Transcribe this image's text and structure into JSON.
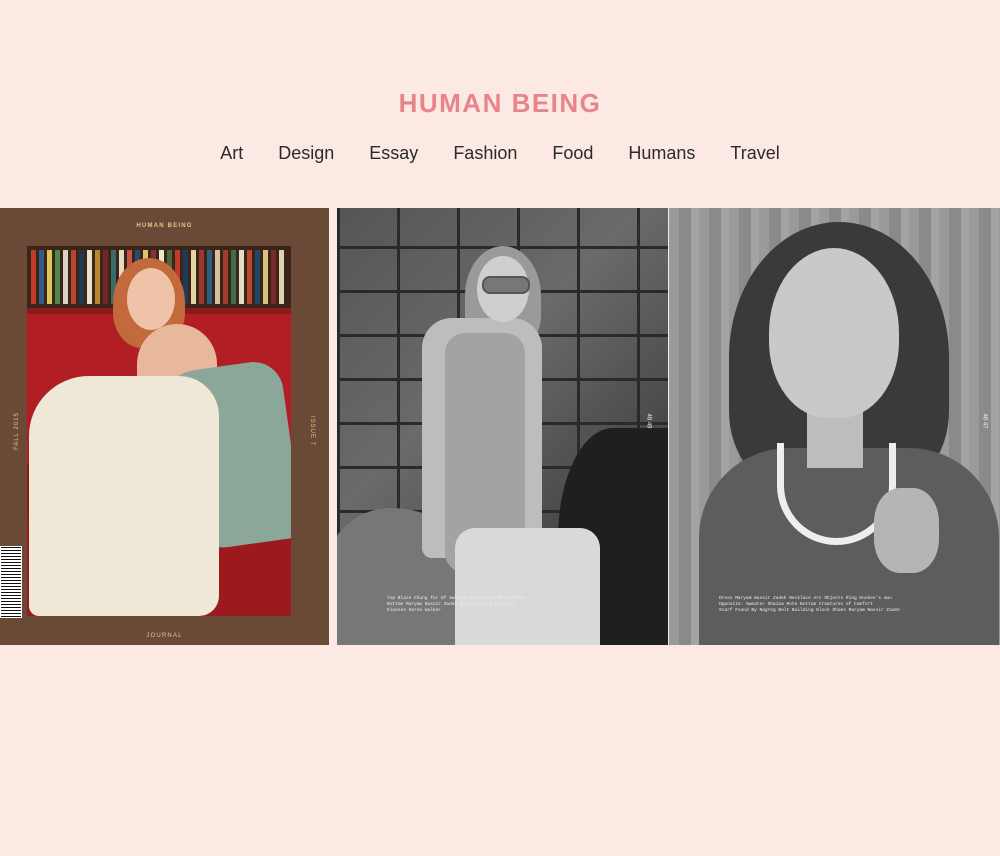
{
  "brand": "HUMAN BEING",
  "nav": [
    "Art",
    "Design",
    "Essay",
    "Fashion",
    "Food",
    "Humans",
    "Travel"
  ],
  "cover": {
    "masthead": "HUMAN BEING",
    "footer": "JOURNAL",
    "season": "FALL 2015",
    "issue": "ISSUE 7"
  },
  "spread_left": {
    "page_number": "48  49",
    "credit": "Top Blaze Chung for Of Sweater Creatures of Comfort\nBottom Maryam Nassir Zadeh Bracelet Arc Objects\nGlasses Karen Walker"
  },
  "spread_right": {
    "page_number": "46  47",
    "credit": "Dress Maryam Nassir Zadeh Necklace Arc Objects Ring Hookes's own\nOpposite: Sweater Shaina Mote Bottom Creatures of Comfort\nScarf Found By Nagreg Belt Building Block Shoes Maryam Nassir Zadeh"
  }
}
